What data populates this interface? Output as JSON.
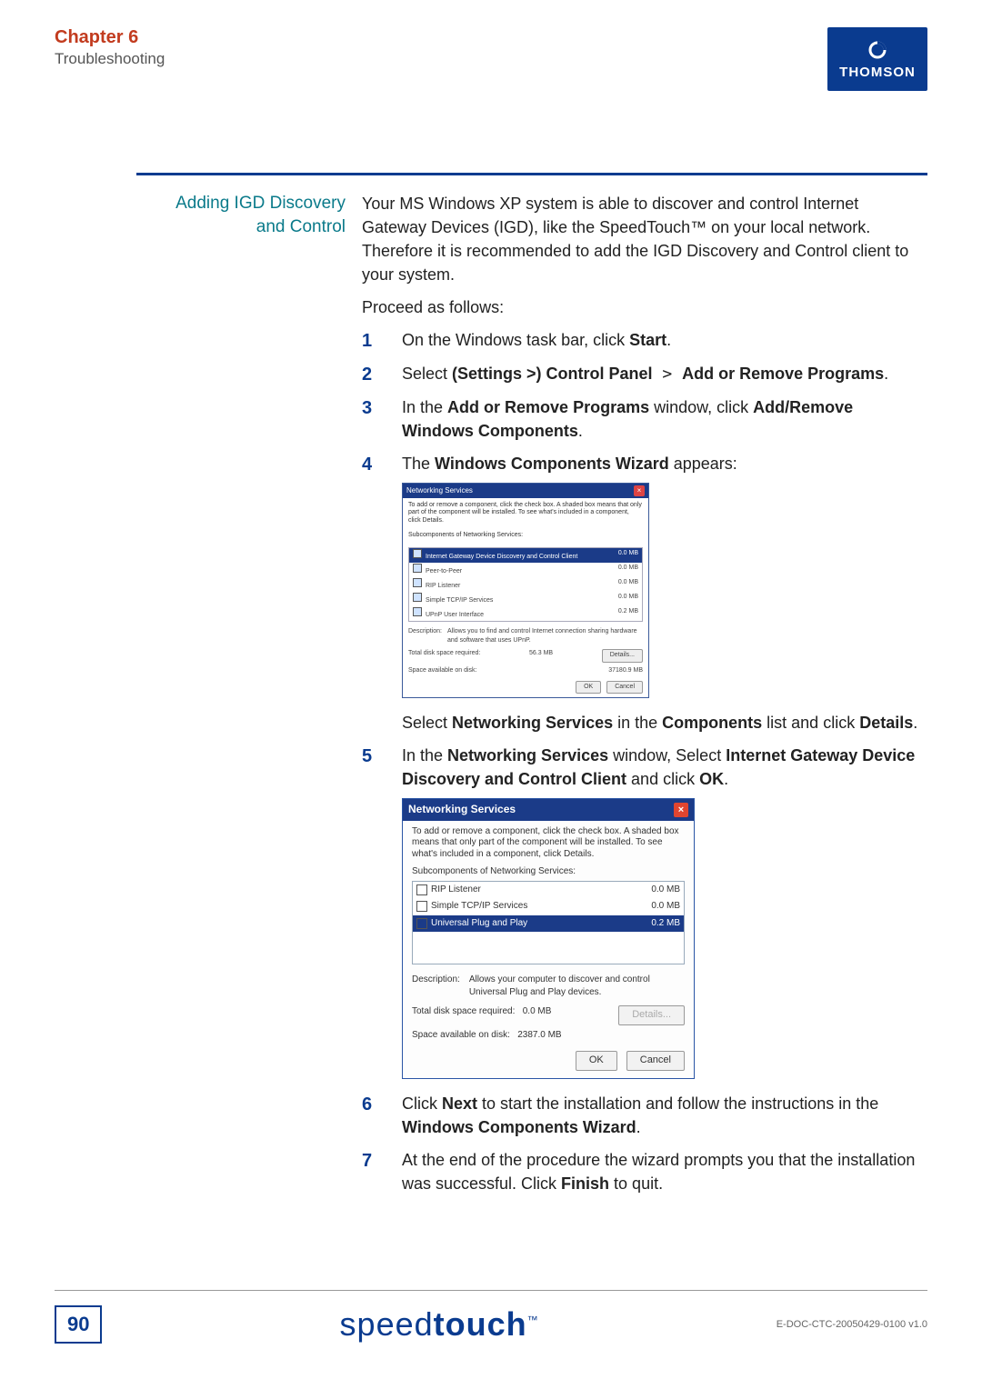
{
  "header": {
    "chapter": "Chapter 6",
    "subtitle": "Troubleshooting",
    "brand_logo": "THOMSON"
  },
  "section": {
    "title_line1": "Adding IGD Discovery",
    "title_line2": "and Control",
    "intro": "Your MS Windows XP system is able to discover and control Internet Gateway Devices (IGD), like the SpeedTouch™ on your local network. Therefore it is recommended to add the IGD Discovery and Control client to your system.",
    "proceed": "Proceed as follows:"
  },
  "steps": {
    "s1": {
      "num": "1",
      "pre": "On the Windows task bar, click ",
      "bold": "Start",
      "post": "."
    },
    "s2": {
      "num": "2",
      "pre": "Select ",
      "b1": "(Settings >) Control Panel",
      "mid": " > ",
      "b2": "Add or Remove Programs",
      "post": "."
    },
    "s3": {
      "num": "3",
      "pre": "In the ",
      "b1": "Add or Remove Programs",
      "mid": " window, click ",
      "b2": "Add/Remove Windows Components",
      "post": "."
    },
    "s4": {
      "num": "4",
      "pre": "The ",
      "b1": "Windows Components Wizard",
      "post": " appears:",
      "after_pre": "Select ",
      "after_b1": "Networking Services",
      "after_mid": " in the ",
      "after_b2": "Components",
      "after_mid2": " list and click ",
      "after_b3": "Details",
      "after_post": "."
    },
    "s5": {
      "num": "5",
      "pre": "In the ",
      "b1": "Networking Services",
      "mid": " window, Select ",
      "b2": "Internet Gateway Device Discovery and Control Client",
      "mid2": " and click ",
      "b3": "OK",
      "post": "."
    },
    "s6": {
      "num": "6",
      "pre": "Click ",
      "b1": "Next",
      "mid": " to start the installation and follow the instructions in the ",
      "b2": "Windows Components Wizard",
      "post": "."
    },
    "s7": {
      "num": "7",
      "pre": "At the end of the procedure the wizard prompts you that the installation was successful. Click ",
      "b1": "Finish",
      "post": " to quit."
    }
  },
  "dlg1": {
    "title": "Networking Services",
    "desc": "To add or remove a component, click the check box. A shaded box means that only part of the component will be installed. To see what's included in a component, click Details.",
    "sublabel": "Subcomponents of Networking Services:",
    "items": [
      {
        "label": "Internet Gateway Device Discovery and Control Client",
        "size": "0.0 MB"
      },
      {
        "label": "Peer-to-Peer",
        "size": "0.0 MB"
      },
      {
        "label": "RIP Listener",
        "size": "0.0 MB"
      },
      {
        "label": "Simple TCP/IP Services",
        "size": "0.0 MB"
      },
      {
        "label": "UPnP User Interface",
        "size": "0.2 MB"
      }
    ],
    "descrow_label": "Description:",
    "descrow_text": "Allows you to find and control Internet connection sharing hardware and software that uses UPnP.",
    "space_req_lbl": "Total disk space required:",
    "space_req_val": "56.3 MB",
    "space_avail_lbl": "Space available on disk:",
    "space_avail_val": "37180.9 MB",
    "details_btn": "Details...",
    "ok": "OK",
    "cancel": "Cancel"
  },
  "dlg2": {
    "title": "Networking Services",
    "desc": "To add or remove a component, click the check box. A shaded box means that only part of the component will be installed. To see what's included in a component, click Details.",
    "sublabel": "Subcomponents of Networking Services:",
    "items": [
      {
        "label": "RIP Listener",
        "size": "0.0 MB",
        "checked": false,
        "sel": false
      },
      {
        "label": "Simple TCP/IP Services",
        "size": "0.0 MB",
        "checked": false,
        "sel": false
      },
      {
        "label": "Universal Plug and Play",
        "size": "0.2 MB",
        "checked": true,
        "sel": true
      }
    ],
    "descrow_label": "Description:",
    "descrow_text": "Allows your computer to discover and control Universal Plug and Play devices.",
    "space_req_lbl": "Total disk space required:",
    "space_req_val": "0.0 MB",
    "space_avail_lbl": "Space available on disk:",
    "space_avail_val": "2387.0 MB",
    "details_btn": "Details...",
    "ok": "OK",
    "cancel": "Cancel"
  },
  "footer": {
    "page": "90",
    "brand_thin": "speed",
    "brand_bold": "touch",
    "tm": "™",
    "docnum": "E-DOC-CTC-20050429-0100 v1.0"
  }
}
